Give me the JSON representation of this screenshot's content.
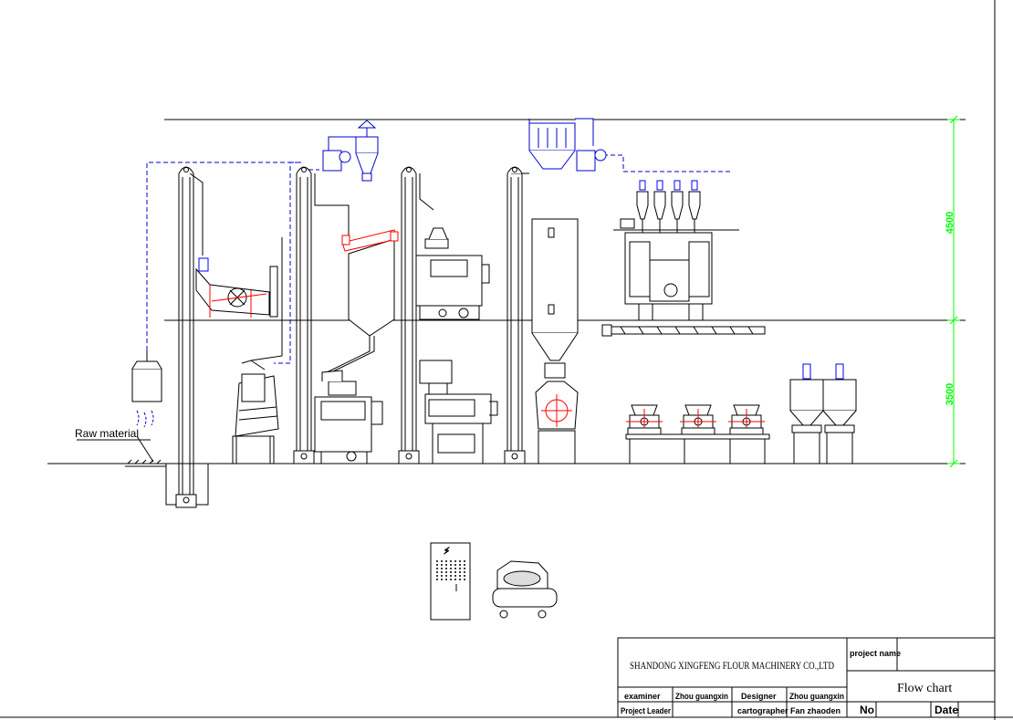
{
  "diagram": {
    "raw_material_label": "Raw material",
    "dimension_upper": "4500",
    "dimension_lower": "3500"
  },
  "title_block": {
    "company": "SHANDONG XINGFENG FLOUR MACHINERY CO.,LTD",
    "project_name_label": "project name",
    "project_name_value": "",
    "drawing_title": "Flow chart",
    "examiner_label": "examiner",
    "examiner_value": "Zhou guangxin",
    "designer_label": "Designer",
    "designer_value": "Zhou guangxin",
    "project_leader_label": "Project Leader",
    "project_leader_value": "",
    "cartographer_label": "cartographer",
    "cartographer_value": "Fan zhaoden",
    "no_label": "No",
    "no_value": "",
    "date_label": "Date",
    "date_value": ""
  },
  "colors": {
    "line": "#000000",
    "duct": "#0000cc",
    "motor": "#0000ff",
    "marker": "#ff0000",
    "dimension": "#00ff00"
  }
}
